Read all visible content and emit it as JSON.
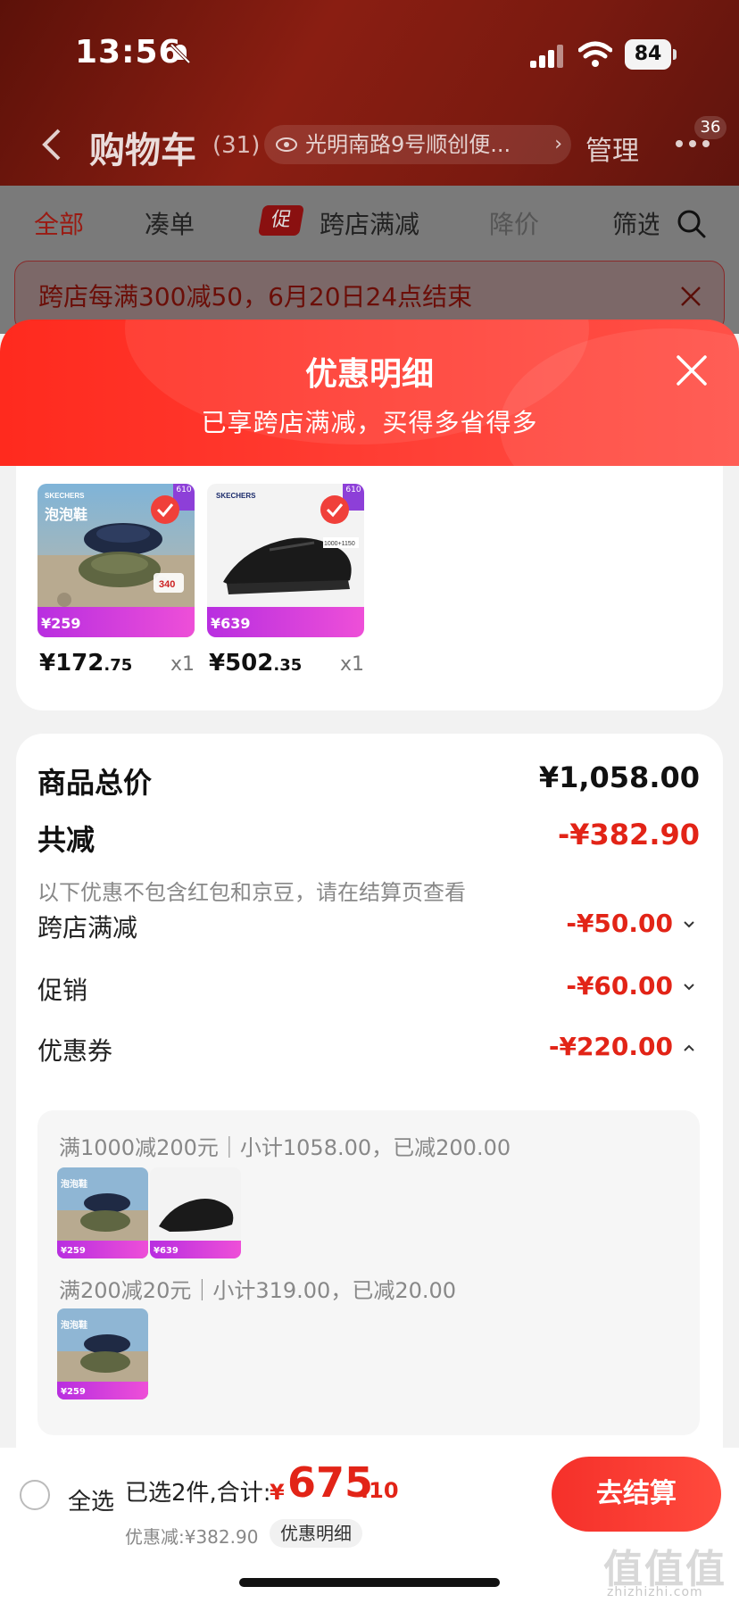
{
  "status_bar": {
    "time": "13:56",
    "battery": "84"
  },
  "nav": {
    "title": "购物车",
    "count": "(31)",
    "address": "光明南路9号顺创便...",
    "manage": "管理",
    "badge": "36"
  },
  "filters": {
    "all": "全部",
    "combine": "凑单",
    "badge": "促",
    "cross_store": "跨店满减",
    "price_drop": "降价",
    "filter": "筛选"
  },
  "promo_strip": {
    "text": "跨店每满300减50，6月20日24点结束"
  },
  "sheet": {
    "title": "优惠明细",
    "subtitle": "已享跨店满减，买得多省得多"
  },
  "products": [
    {
      "price_int": "¥172",
      "price_dec": ".75",
      "qty": "x1",
      "promo_price": "¥259",
      "brand": "SKECHERS"
    },
    {
      "price_int": "¥502",
      "price_dec": ".35",
      "qty": "x1",
      "promo_price": "¥639",
      "brand": "SKECHERS"
    }
  ],
  "summary": {
    "total_label": "商品总价",
    "total_value": "¥1,058.00",
    "reduce_label": "共减",
    "reduce_value": "-¥382.90",
    "note": "以下优惠不包含红包和京豆，请在结算页查看",
    "rows": [
      {
        "label": "跨店满减",
        "value": "-¥50.00"
      },
      {
        "label": "促销",
        "value": "-¥60.00"
      },
      {
        "label": "优惠券",
        "value": "-¥220.00"
      }
    ]
  },
  "coupons": [
    {
      "text": "满1000减200元｜小计1058.00，已减200.00"
    },
    {
      "text": "满200减20元｜小计319.00，已减20.00"
    }
  ],
  "bottom": {
    "select_all": "全选",
    "selected": "已选2件,合计:",
    "currency": "¥",
    "total_int": "675",
    "total_dec": ".10",
    "discount": "优惠减:¥382.90",
    "detail": "优惠明细",
    "checkout": "去结算",
    "watermark": "值值值",
    "watermark_sub": "zhizhizhi.com"
  },
  "colors": {
    "accent": "#e22417",
    "sheet_header": "#ff3d33",
    "checkout": "#f5302a"
  }
}
